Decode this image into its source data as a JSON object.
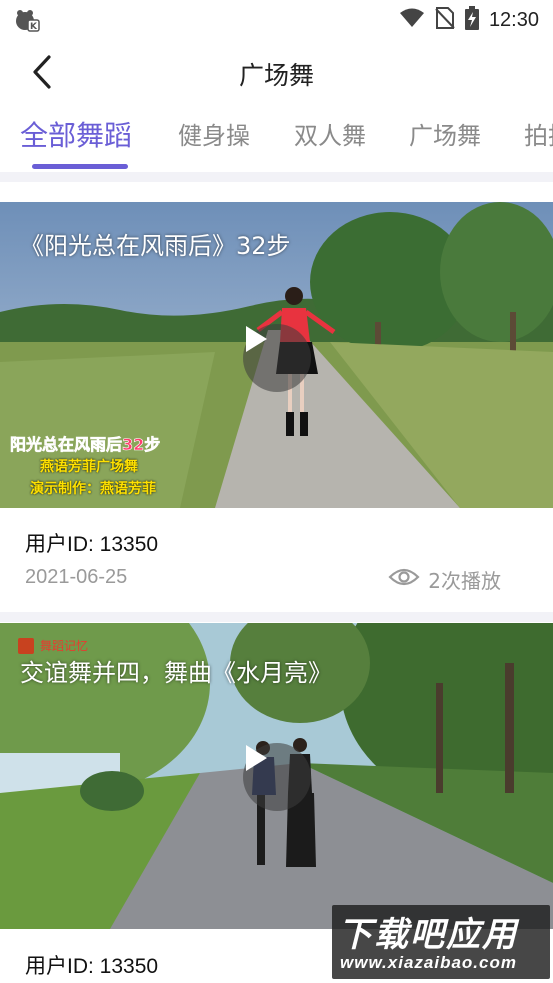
{
  "status_bar": {
    "time": "12:30",
    "icons": [
      "app-badge-icon",
      "wifi-icon",
      "no-sim-icon",
      "battery-charging-icon"
    ]
  },
  "header": {
    "title": "广场舞",
    "back_icon": "chevron-left-icon"
  },
  "tabs": [
    {
      "label": "全部舞蹈",
      "active": true
    },
    {
      "label": "健身操",
      "active": false
    },
    {
      "label": "双人舞",
      "active": false
    },
    {
      "label": "广场舞",
      "active": false
    },
    {
      "label": "拍拍",
      "active": false
    }
  ],
  "colors": {
    "accent": "#6a5ed6",
    "muted": "#9a9a9a",
    "divider": "#f2f2f7"
  },
  "videos": [
    {
      "title": "《阳光总在风雨后》32步",
      "overlay_lines": [
        "阳光总在风雨后32步",
        "燕语芳菲广场舞",
        "演示制作：燕语芳菲"
      ],
      "user_id": "用户ID: 13350",
      "date": "2021-06-25",
      "plays": "2次播放"
    },
    {
      "title": "交谊舞并四，舞曲《水月亮》",
      "tag": "舞蹈记忆",
      "user_id": "用户ID: 13350"
    }
  ],
  "watermark": {
    "main": "下载吧应用",
    "sub": "www.xiazaibao.com"
  }
}
